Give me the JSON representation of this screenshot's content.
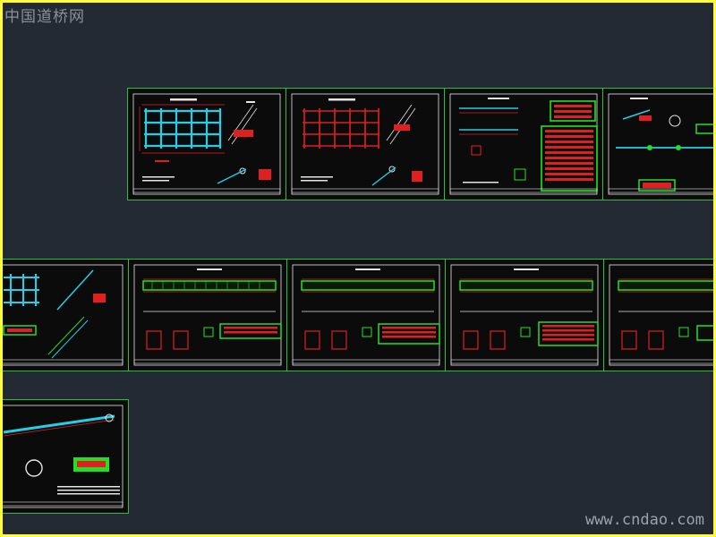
{
  "app": {
    "watermark_top": "中国道桥网",
    "watermark_bottom": "www.cndao.com"
  },
  "colors": {
    "background": "#232a33",
    "sheet_border": "#23c23a",
    "sheet_fill": "#0b0b0b",
    "frame_border": "#ffff33",
    "cad_red": "#e02020",
    "cad_green": "#24e024",
    "cad_cyan": "#22cfe6",
    "cad_white": "#e6e6e6"
  },
  "sheets": {
    "row1": [
      {
        "kind": "grid-plan"
      },
      {
        "kind": "grid-plan"
      },
      {
        "kind": "table-sheet"
      },
      {
        "kind": "detail-sheet"
      }
    ],
    "row2": [
      {
        "kind": "grid-plan-partial"
      },
      {
        "kind": "beam-elevation"
      },
      {
        "kind": "beam-elevation"
      },
      {
        "kind": "beam-elevation"
      },
      {
        "kind": "beam-elevation"
      }
    ],
    "row3": [
      {
        "kind": "pipe-detail"
      }
    ]
  }
}
